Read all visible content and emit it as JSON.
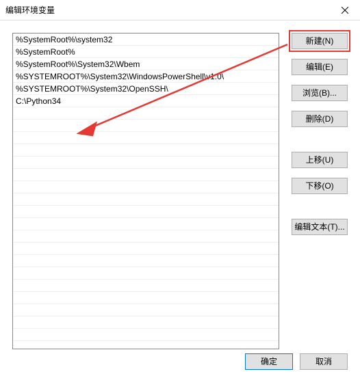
{
  "window": {
    "title": "编辑环境变量"
  },
  "list": {
    "items": [
      "%SystemRoot%\\system32",
      "%SystemRoot%",
      "%SystemRoot%\\System32\\Wbem",
      "%SYSTEMROOT%\\System32\\WindowsPowerShell\\v1.0\\",
      "%SYSTEMROOT%\\System32\\OpenSSH\\",
      "C:\\Python34"
    ]
  },
  "buttons": {
    "new": "新建(N)",
    "edit": "编辑(E)",
    "browse": "浏览(B)...",
    "delete": "删除(D)",
    "moveup": "上移(U)",
    "movedown": "下移(O)",
    "edittext": "编辑文本(T)...",
    "ok": "确定",
    "cancel": "取消"
  }
}
